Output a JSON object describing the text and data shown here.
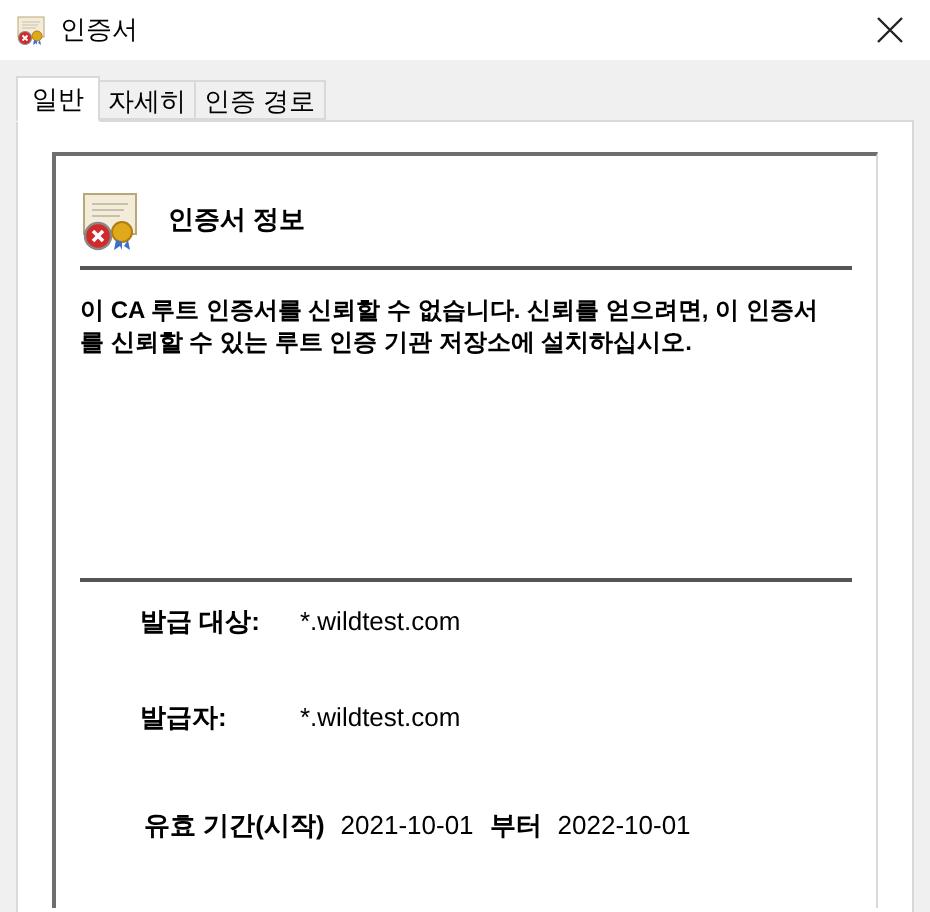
{
  "window": {
    "title": "인증서",
    "trusted": false
  },
  "tabs": [
    {
      "label": "일반",
      "selected": true
    },
    {
      "label": "자세히",
      "selected": false
    },
    {
      "label": "인증 경로",
      "selected": false
    }
  ],
  "certificate_info": {
    "heading": "인증서 정보",
    "trusted": false,
    "message": "이 CA 루트 인증서를 신뢰할 수 없습니다. 신뢰를 얻으려면, 이 인증서를 신뢰할 수 있는 루트 인증 기관 저장소에 설치하십시오."
  },
  "fields": [
    {
      "label": "발급 대상:",
      "value": "*.wildtest.com"
    },
    {
      "label": "발급자:",
      "value": "*.wildtest.com"
    }
  ],
  "validity": {
    "label": "유효 기간(시작)",
    "from": "2021-10-01",
    "separator": "부터",
    "to": "2022-10-01"
  }
}
